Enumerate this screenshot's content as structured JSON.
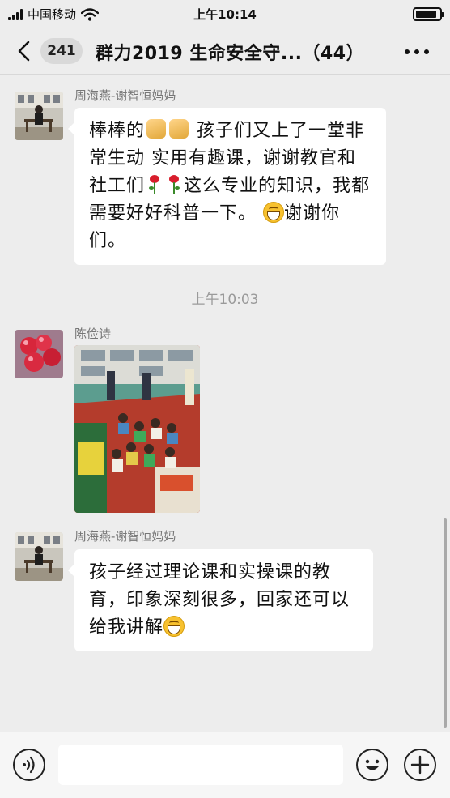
{
  "status_bar": {
    "carrier": "中国移动",
    "time": "上午10:14",
    "battery_level": 0.9
  },
  "nav": {
    "unread_count": "241",
    "title": "群力2019 生命安全守...（44）"
  },
  "messages": [
    {
      "sender": "周海燕-谢智恒妈妈",
      "parts": {
        "p1": "棒棒的",
        "p2": "孩子们又上了一堂非常生动 实用有趣课，谢谢教官和社工们",
        "p3": "这么专业的知识，我都需要好好科普一下。",
        "p4": "谢谢你们。"
      }
    },
    {
      "time": "上午10:03"
    },
    {
      "sender": "陈俭诗",
      "type": "image"
    },
    {
      "sender": "周海燕-谢智恒妈妈",
      "parts": {
        "p1": "孩子经过理论课和实操课的教育，印象深刻很多，回家还可以给我讲解"
      }
    }
  ],
  "input": {
    "value": "",
    "placeholder": ""
  },
  "icons": {
    "back": "chevron-left-icon",
    "more": "more-icon",
    "voice": "voice-icon",
    "emoji": "emoji-icon",
    "plus": "plus-icon"
  }
}
